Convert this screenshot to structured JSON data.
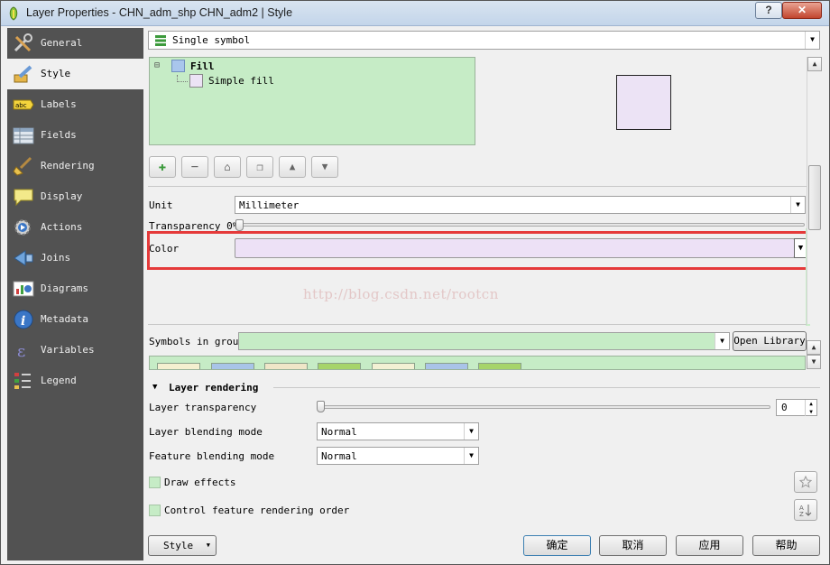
{
  "window": {
    "title": "Layer Properties - CHN_adm_shp CHN_adm2 | Style",
    "help_glyph": "?",
    "close_glyph": "✕"
  },
  "sidebar": {
    "items": [
      {
        "label": "General",
        "icon": "wrench-screwdriver-icon"
      },
      {
        "label": "Style",
        "icon": "paintbrush-style-icon"
      },
      {
        "label": "Labels",
        "icon": "abc-label-icon"
      },
      {
        "label": "Fields",
        "icon": "table-fields-icon"
      },
      {
        "label": "Rendering",
        "icon": "broom-rendering-icon"
      },
      {
        "label": "Display",
        "icon": "speech-bubble-icon"
      },
      {
        "label": "Actions",
        "icon": "gear-play-icon"
      },
      {
        "label": "Joins",
        "icon": "joins-arrow-icon"
      },
      {
        "label": "Diagrams",
        "icon": "diagram-chart-icon"
      },
      {
        "label": "Metadata",
        "icon": "info-icon"
      },
      {
        "label": "Variables",
        "icon": "epsilon-icon"
      },
      {
        "label": "Legend",
        "icon": "legend-icon"
      }
    ],
    "active_index": 1
  },
  "renderer": {
    "selected": "Single symbol",
    "icon": "single-symbol-icon"
  },
  "symbol_tree": {
    "root": "Fill",
    "child": "Simple fill",
    "expand_glyph": "⊟"
  },
  "tool_buttons": {
    "add_glyph": "✚",
    "remove_glyph": "−",
    "lock_glyph": "⌂",
    "duplicate_glyph": "❐",
    "up_glyph": "▲",
    "down_glyph": "▼"
  },
  "unit": {
    "label": "Unit",
    "value": "Millimeter"
  },
  "transparency": {
    "label": "Transparency 0%",
    "value": 0
  },
  "color": {
    "label": "Color",
    "value": "#ede1f6"
  },
  "watermark": "http://blog.csdn.net/rootcn",
  "symbols_in_group": {
    "label": "Symbols in group",
    "value": "",
    "open_library": "Open Library"
  },
  "swatches": [
    "#f4f0d0",
    "#a8c4e8",
    "#efe6c8",
    "#a6d46a",
    "#f3f1d4",
    "#a9c3e8",
    "#a6d46a"
  ],
  "layer_rendering": {
    "header": "Layer rendering",
    "layer_transparency_label": "Layer transparency",
    "layer_transparency_value": "0",
    "layer_blending_label": "Layer blending mode",
    "layer_blending_value": "Normal",
    "feature_blending_label": "Feature blending mode",
    "feature_blending_value": "Normal",
    "draw_effects": "Draw effects",
    "control_order": "Control feature rendering order"
  },
  "buttons": {
    "style": "Style",
    "ok": "确定",
    "cancel": "取消",
    "apply": "应用",
    "help": "帮助"
  },
  "glyphs": {
    "down": "▼",
    "up": "▲",
    "triangle_expanded": "▼"
  }
}
